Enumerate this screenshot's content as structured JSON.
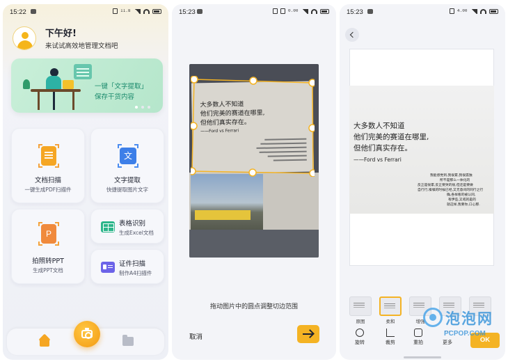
{
  "screen1": {
    "status_time": "15:22",
    "status_speed": "11.8 KB/s",
    "greeting": "下午好!",
    "greeting_sub": "来试试高效地管理文档吧",
    "banner": {
      "line1": "一键「文字提取」",
      "line2": "保存干货内容"
    },
    "cards": [
      {
        "label": "文档扫描",
        "sub": "一键生成PDF扫描件",
        "icon": "document-scan-icon",
        "color": "#f5a623"
      },
      {
        "label": "文字提取",
        "sub": "快捷提取图片文字",
        "icon": "text-extract-icon",
        "color": "#3d7fe8"
      },
      {
        "label": "拍照转PPT",
        "sub": "生成PPT文档",
        "icon": "ppt-icon",
        "color": "#f08a3c"
      },
      {
        "label": "表格识别",
        "sub": "生成Excel文档",
        "icon": "excel-table-icon",
        "color": "#2bb58a"
      },
      {
        "label": "证件扫描",
        "sub": "制作A4扫描件",
        "icon": "id-card-icon",
        "color": "#6c63e8"
      }
    ],
    "txt_glyph": "文",
    "ppt_glyph": "P",
    "nav": {
      "home": "home-icon",
      "camera": "camera-icon",
      "files": "folder-icon"
    }
  },
  "screen2": {
    "status_time": "15:23",
    "status_speed": "0.00 KB/s",
    "photo_text": {
      "line1": "大多数人不知道",
      "line2": "他们完美的赛道在哪里,",
      "line3": "但他们真实存在。",
      "line4": "——Ford vs Ferrari"
    },
    "hint": "拖动图片中的圆点调整切边范围",
    "cancel": "取消",
    "next_icon": "arrow-right-icon"
  },
  "screen3": {
    "status_time": "15:23",
    "status_speed": "4.00 KB/s",
    "scan_text": {
      "line1": "大多数人不知道",
      "line2": "他们完美的赛道在哪里,",
      "line3": "但他们真实存在。",
      "line4": "——Ford vs Ferrari",
      "p1": "我能感觉到,我很累,我很孤独",
      "p2": "所不是那么一体化的",
      "p3": "反正是很累,反正要哭的很,但还是要做",
      "p4": "自行行,嗓嗓的时候已经,又无意间的同行之行",
      "p5": "确,各样看的被认同,",
      "p6": "有伊些,又或的是的",
      "p7": "就这样,我要你,口心那."
    },
    "filters": [
      "原图",
      "柔和",
      "增强",
      "",
      ""
    ],
    "selected_filter": 1,
    "tools": [
      "旋转",
      "裁剪",
      "重拍",
      "更多"
    ],
    "ok": "OK",
    "watermark": {
      "cn": "泡泡网",
      "en": "PCPOP.COM"
    }
  }
}
